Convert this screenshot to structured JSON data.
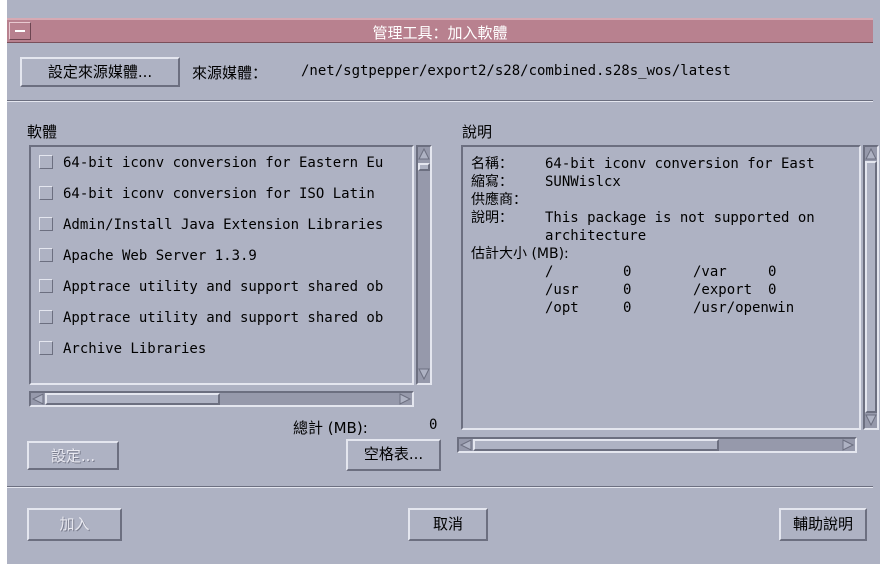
{
  "window": {
    "title": "管理工具：加入軟體"
  },
  "source": {
    "set_button": "設定來源媒體...",
    "label": "來源媒體：",
    "path": "/net/sgtpepper/export2/s28/combined.s28s_wos/latest"
  },
  "software": {
    "heading": "軟體",
    "items": [
      "64-bit iconv conversion for Eastern Eu",
      "64-bit iconv conversion for ISO Latin",
      "Admin/Install Java Extension Libraries",
      "Apache Web Server 1.3.9",
      "Apptrace utility and support shared ob",
      "Apptrace utility and support shared ob",
      "Archive Libraries"
    ],
    "total_label": "總計 (MB):",
    "total_value": "0",
    "settings_button": "設定...",
    "disk_space_button": "空格表..."
  },
  "description": {
    "heading": "說明",
    "name_label": "名稱：",
    "name_value": "64-bit iconv conversion for East",
    "abbr_label": "縮寫：",
    "abbr_value": "SUNWislcx",
    "vendor_label": "供應商：",
    "vendor_value": "",
    "desc_label": "說明：",
    "desc_line1": "This package is not supported on",
    "desc_line2": "architecture",
    "size_label": "估計大小 (MB):",
    "sizes": [
      {
        "path1": "/",
        "val1": "0",
        "path2": "/var",
        "val2": "0"
      },
      {
        "path1": "/usr",
        "val1": "0",
        "path2": "/export",
        "val2": "0"
      },
      {
        "path1": "/opt",
        "val1": "0",
        "path2": "/usr/openwin",
        "val2": ""
      }
    ]
  },
  "footer": {
    "add_button": "加入",
    "cancel_button": "取消",
    "help_button": "輔助說明"
  },
  "colors": {
    "window_bg": "#aeb2c3",
    "titlebar": "#b8818f"
  }
}
